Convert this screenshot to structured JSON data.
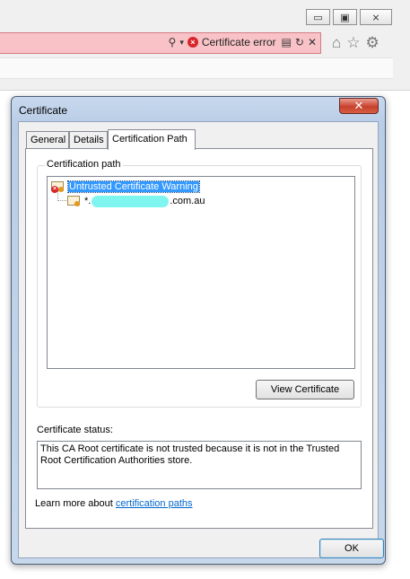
{
  "browser": {
    "window_buttons": [
      "▭",
      "▣",
      "⨯"
    ],
    "address_status": "Certificate error",
    "nav_icons": [
      "home-icon",
      "star-icon",
      "gear-icon"
    ]
  },
  "dialog": {
    "title": "Certificate",
    "close_glyph": "✕",
    "tabs": [
      {
        "label": "General"
      },
      {
        "label": "Details"
      },
      {
        "label": "Certification Path"
      }
    ],
    "path_group_label": "Certification path",
    "tree": {
      "root_label": "Untrusted Certificate Warning",
      "child_prefix": "*.",
      "child_suffix": ".com.au"
    },
    "view_cert_button": "View Certificate",
    "status_label": "Certificate status:",
    "status_text": "This CA Root certificate is not trusted because it is not in the Trusted Root Certification Authorities store.",
    "learn_prefix": "Learn more about ",
    "learn_link": "certification paths",
    "ok_button": "OK"
  }
}
